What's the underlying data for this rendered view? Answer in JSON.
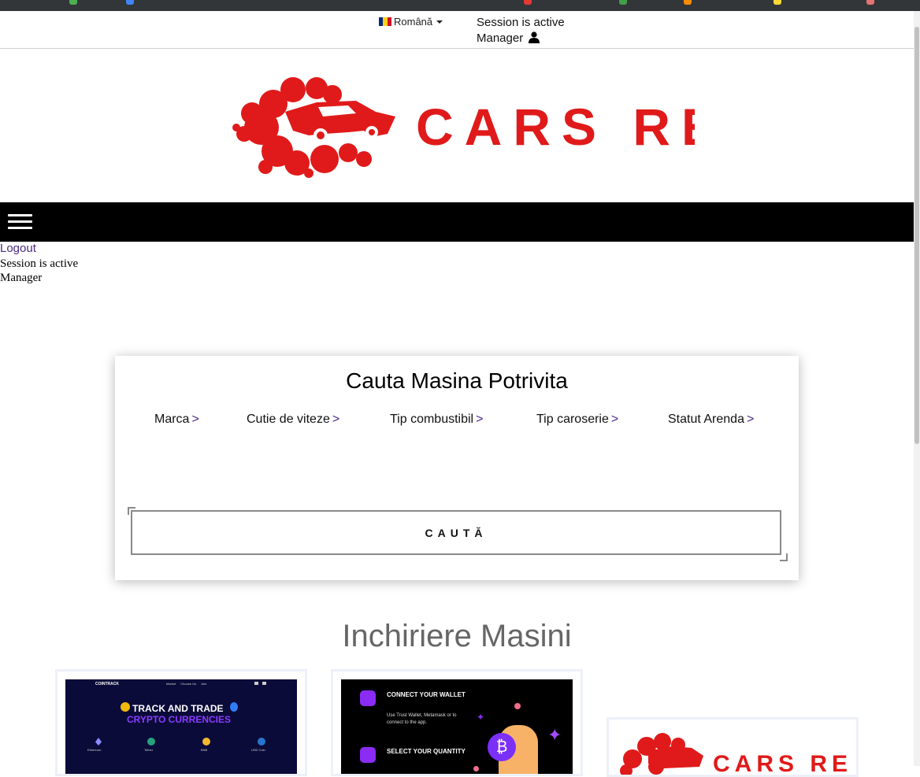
{
  "header": {
    "language": "Română",
    "session_status": "Session is active",
    "user_role": "Manager"
  },
  "brand": {
    "name": "CARS RENT",
    "accent_color": "#e01a1a"
  },
  "nav": {
    "menu_icon": "hamburger-menu-icon",
    "logout_label": "Logout",
    "session_status": "Session is active",
    "user_role": "Manager"
  },
  "search": {
    "title": "Cauta Masina Potrivita",
    "filters": [
      {
        "label": "Marca",
        "arrow": ">"
      },
      {
        "label": "Cutie de viteze",
        "arrow": ">"
      },
      {
        "label": "Tip combustibil",
        "arrow": ">"
      },
      {
        "label": "Tip caroserie",
        "arrow": ">"
      },
      {
        "label": "Statut Arenda",
        "arrow": ">"
      }
    ],
    "button_label": "CAUTĂ"
  },
  "listings": {
    "title": "Inchiriere Masini",
    "cards": [
      {
        "brand": "COINTRACK",
        "nav": [
          "Market",
          "Choose Us",
          "Join"
        ],
        "headline_1": "TRACK AND TRADE",
        "headline_2": "CRYPTO CURRENCIES",
        "coins": [
          "Ethereum",
          "Tether",
          "BNB",
          "USD Coin"
        ]
      },
      {
        "step_1_title": "CONNECT YOUR WALLET",
        "step_1_text": "Use Trust Wallet, Metamask or to connect to the app.",
        "step_2_title": "SELECT YOUR QUANTITY"
      },
      {
        "brand": "CARS RENT"
      }
    ]
  }
}
